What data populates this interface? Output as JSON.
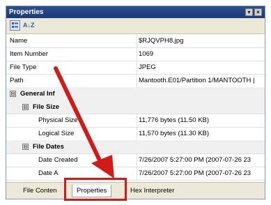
{
  "window": {
    "title": "Properties",
    "buttons": [
      "▾",
      "×"
    ]
  },
  "toolbar": {
    "categorized_icon": "categorized-view-icon",
    "alphabetical_icon": "alphabetical-sort-icon",
    "alphabetical_glyph": "A↓Z"
  },
  "properties": {
    "name": {
      "label": "Name",
      "value": "$RJQVPH8.jpg"
    },
    "item_number": {
      "label": "Item Number",
      "value": "1069"
    },
    "file_type": {
      "label": "File Type",
      "value": "JPEG"
    },
    "path": {
      "label": "Path",
      "value": "Mantooth.E01/Partition 1/MANTOOTH |"
    },
    "general_info": {
      "label": "General Inf",
      "toggle": "⊟"
    },
    "file_size": {
      "label": "File Size",
      "toggle": "⊟"
    },
    "physical_size": {
      "label": "Physical Size",
      "value": "11,776 bytes  (11.50 KB)"
    },
    "logical_size": {
      "label": "Logical Size",
      "value": "11,570 bytes  (11.30 KB)"
    },
    "file_dates": {
      "label": "File Dates",
      "toggle": "⊟"
    },
    "date_created": {
      "label": "Date Created",
      "value": "7/26/2007 5:27:00 PM (2007-07-26 23"
    },
    "date_accessed": {
      "label": "Date A",
      "value": "7/26/2007 5:27:00 PM (2007-07-26 23"
    }
  },
  "tabs": [
    {
      "label": "File Conten"
    },
    {
      "label": "Properties"
    },
    {
      "label": "Hex Interpreter"
    }
  ],
  "annotation": {
    "arrow_color": "#d11a1a",
    "highlight_color": "#d11a1a"
  }
}
